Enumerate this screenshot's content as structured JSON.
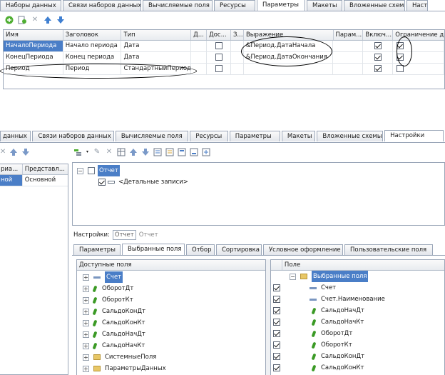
{
  "top": {
    "tabs": [
      "Наборы данных",
      "Связи наборов данных",
      "Вычисляемые поля",
      "Ресурсы",
      "Параметры",
      "Макеты",
      "Вложенные схемы",
      "Наст"
    ],
    "active_tab": 4,
    "columns": [
      "Имя",
      "Заголовок",
      "Тип",
      "Д...",
      "Дос...",
      "З...",
      "Выражение",
      "Парам...",
      "Включ...",
      "Ограничение д"
    ],
    "rows": [
      {
        "name": "НачалоПериода",
        "title": "Начало периода",
        "type": "Дата",
        "dos": false,
        "expr": "&Период.ДатаНачала",
        "incl": true,
        "restr": true
      },
      {
        "name": "КонецПериода",
        "title": "Конец периода",
        "type": "Дата",
        "dos": false,
        "expr": "&Период.ДатаОкончания",
        "incl": true,
        "restr": true
      },
      {
        "name": "Период",
        "title": "Период",
        "type": "СтандартныйПериод",
        "dos": false,
        "expr": "",
        "incl": true,
        "restr": false
      }
    ]
  },
  "bottom": {
    "tabs": [
      "данных",
      "Связи наборов данных",
      "Вычисляемые поля",
      "Ресурсы",
      "Параметры",
      "Макеты",
      "Вложенные схемы",
      "Настройки"
    ],
    "active_tab": 7,
    "left_cols": [
      "риа...",
      "Представл..."
    ],
    "left_row": {
      "c1": "ной",
      "c2": "Основной"
    },
    "tree_root": "Отчет",
    "tree_child": "<Детальные записи>",
    "settings_label": "Настройки:",
    "settings_opt1": "Отчет",
    "settings_opt2": "Отчет",
    "sub_tabs": [
      "Параметры",
      "Выбранные поля",
      "Отбор",
      "Сортировка",
      "Условное оформление",
      "Пользовательские поля"
    ],
    "sub_active": 1,
    "available_header": "Доступные поля",
    "available": [
      {
        "label": "Счет",
        "icon": "dash",
        "sel": true
      },
      {
        "label": "ОборотДт",
        "icon": "leaf"
      },
      {
        "label": "ОборотКт",
        "icon": "leaf"
      },
      {
        "label": "СальдоКонДт",
        "icon": "leaf"
      },
      {
        "label": "СальдоКонКт",
        "icon": "leaf"
      },
      {
        "label": "СальдоНачДт",
        "icon": "leaf"
      },
      {
        "label": "СальдоНачКт",
        "icon": "leaf"
      },
      {
        "label": "СистемныеПоля",
        "icon": "folder"
      },
      {
        "label": "ПараметрыДанных",
        "icon": "folder"
      }
    ],
    "field_header": "Поле",
    "fields_root": "Выбранные поля",
    "fields": [
      {
        "label": "Счет",
        "icon": "dash"
      },
      {
        "label": "Счет.Наименование",
        "icon": "dash"
      },
      {
        "label": "СальдоНачДт",
        "icon": "leaf"
      },
      {
        "label": "СальдоНачКт",
        "icon": "leaf"
      },
      {
        "label": "ОборотДт",
        "icon": "leaf"
      },
      {
        "label": "ОборотКт",
        "icon": "leaf"
      },
      {
        "label": "СальдоКонДт",
        "icon": "leaf"
      },
      {
        "label": "СальдоКонКт",
        "icon": "leaf"
      }
    ]
  }
}
